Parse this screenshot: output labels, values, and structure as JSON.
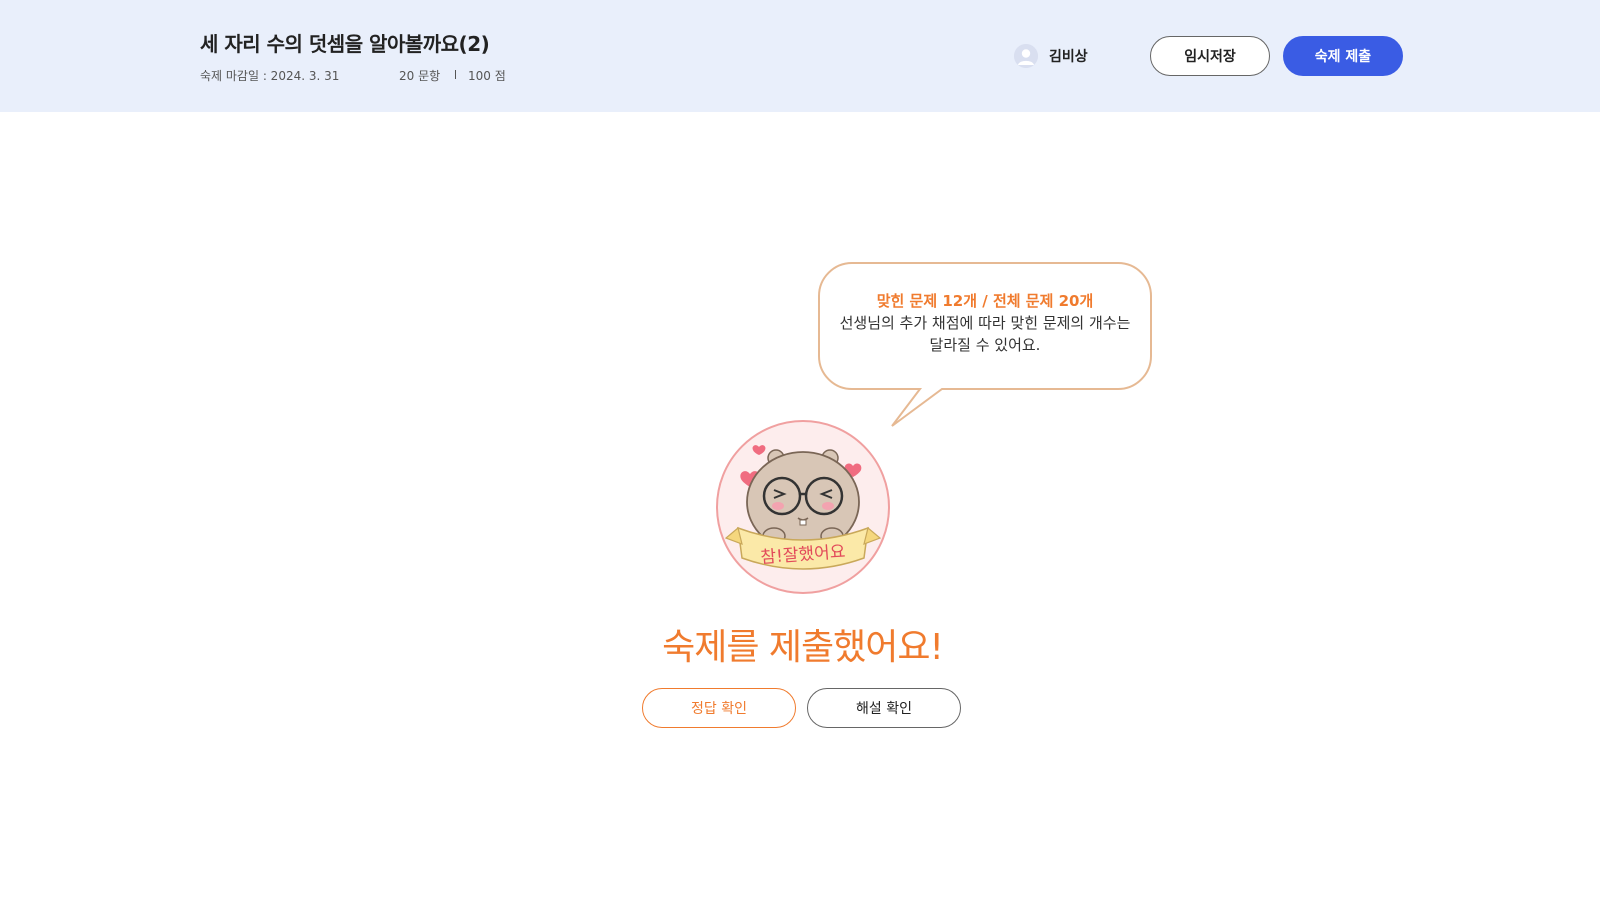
{
  "header": {
    "title": "세 자리 수의 덧셈을 알아볼까요(2)",
    "due_date": "숙제 마감일 : 2024. 3. 31",
    "question_count": "20 문항",
    "score": "100 점",
    "user_name": "김비상",
    "save_label": "임시저장",
    "submit_label": "숙제 제출"
  },
  "result": {
    "bubble_highlight": "맞힌 문제 12개 / 전체 문제 20개",
    "bubble_message": "선생님의 추가 채점에 따라 맞힌 문제의 개수는 달라질 수 있어요.",
    "mascot_banner": "참!잘했어요",
    "done_title": "숙제를 제출했어요!",
    "answer_button": "정답 확인",
    "explain_button": "해설 확인",
    "correct_count": 12,
    "total_count": 20
  },
  "icons": {
    "avatar": "user-avatar-icon",
    "mascot": "hamster-mascot-icon"
  },
  "colors": {
    "header_bg": "#e9effb",
    "primary": "#3a5ce4",
    "accent": "#f07b2e",
    "bubble_border": "#e6b993"
  }
}
